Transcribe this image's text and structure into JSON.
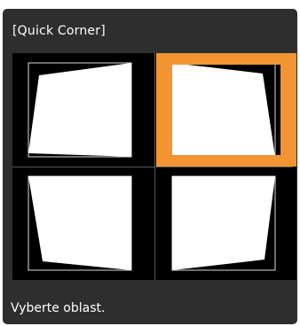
{
  "dialog": {
    "title": "[Quick Corner]",
    "status_text": "Vyberte oblast.",
    "selected_area": "top-right"
  },
  "areas": [
    {
      "position": "top-left",
      "selected": false
    },
    {
      "position": "top-right",
      "selected": true
    },
    {
      "position": "bottom-left",
      "selected": false
    },
    {
      "position": "bottom-right",
      "selected": false
    }
  ],
  "colors": {
    "dialog_bg": "#2e2e2e",
    "area_bg": "#000000",
    "selection": "#f39433",
    "image_fill": "#ffffff",
    "outline": "#dcdcdc"
  }
}
